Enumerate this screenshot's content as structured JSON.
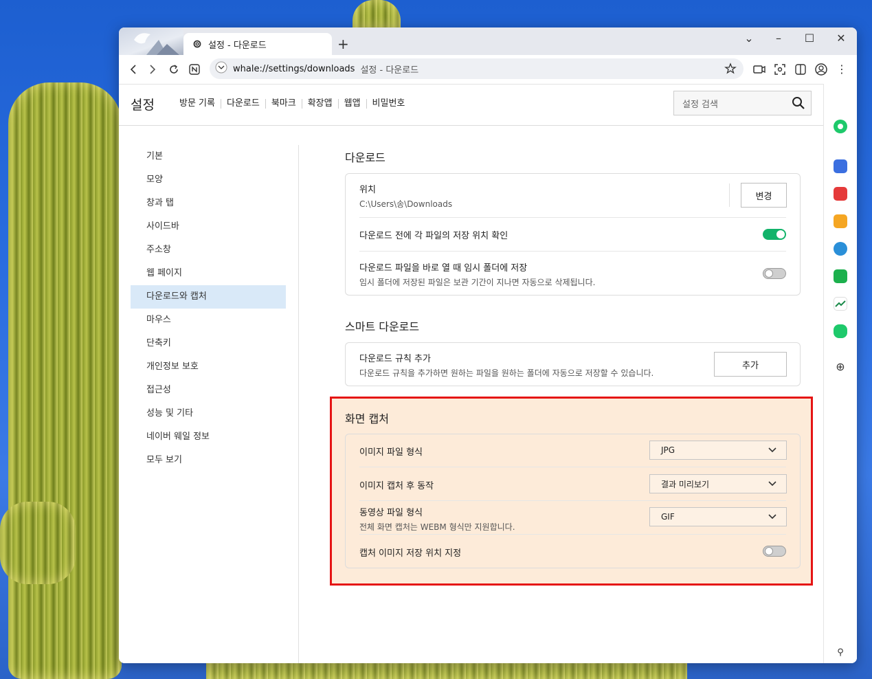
{
  "browser": {
    "tab_title": "설정 - 다운로드",
    "new_tab": "+",
    "url": "whale://settings/downloads",
    "page_title": "설정 - 다운로드"
  },
  "settings": {
    "title": "설정",
    "topnav": [
      "방문 기록",
      "다운로드",
      "북마크",
      "확장앱",
      "웹앱",
      "비밀번호"
    ],
    "search_placeholder": "설정 검색"
  },
  "sidebar": {
    "items": [
      {
        "label": "기본"
      },
      {
        "label": "모양"
      },
      {
        "label": "창과 탭"
      },
      {
        "label": "사이드바"
      },
      {
        "label": "주소창"
      },
      {
        "label": "웹 페이지"
      },
      {
        "label": "다운로드와 캡처",
        "active": true
      },
      {
        "label": "마우스"
      },
      {
        "label": "단축키"
      },
      {
        "label": "개인정보 보호"
      },
      {
        "label": "접근성"
      },
      {
        "label": "성능 및 기타"
      },
      {
        "label": "네이버 웨일 정보"
      },
      {
        "label": "모두 보기"
      }
    ]
  },
  "download": {
    "section_title": "다운로드",
    "location_label": "위치",
    "location_value": "C:\\Users\\송\\Downloads",
    "change_button": "변경",
    "ask_location_label": "다운로드 전에 각 파일의 저장 위치 확인",
    "ask_location_on": true,
    "temp_folder_label": "다운로드 파일을 바로 열 때 임시 폴더에 저장",
    "temp_folder_sub": "임시 폴더에 저장된 파일은 보관 기간이 지나면 자동으로 삭제됩니다.",
    "temp_folder_on": false
  },
  "smart_download": {
    "section_title": "스마트 다운로드",
    "rule_label": "다운로드 규칙 추가",
    "rule_sub": "다운로드 규칙을 추가하면 원하는 파일을 원하는 폴더에 자동으로 저장할 수 있습니다.",
    "add_button": "추가"
  },
  "capture": {
    "section_title": "화면 캡처",
    "image_format_label": "이미지 파일 형식",
    "image_format_value": "JPG",
    "after_capture_label": "이미지 캡처 후 동작",
    "after_capture_value": "결과 미리보기",
    "video_format_label": "동영상 파일 형식",
    "video_format_sub": "전체 화면 캡처는 WEBM 형식만 지원합니다.",
    "video_format_value": "GIF",
    "save_location_label": "캡처 이미지 저장 위치 지정",
    "save_location_on": false
  },
  "colors": {
    "accent_active_bg": "#d9e9f8",
    "toggle_on": "#12b36a",
    "highlight_border": "#e51414",
    "highlight_bg": "#fdebd9"
  }
}
